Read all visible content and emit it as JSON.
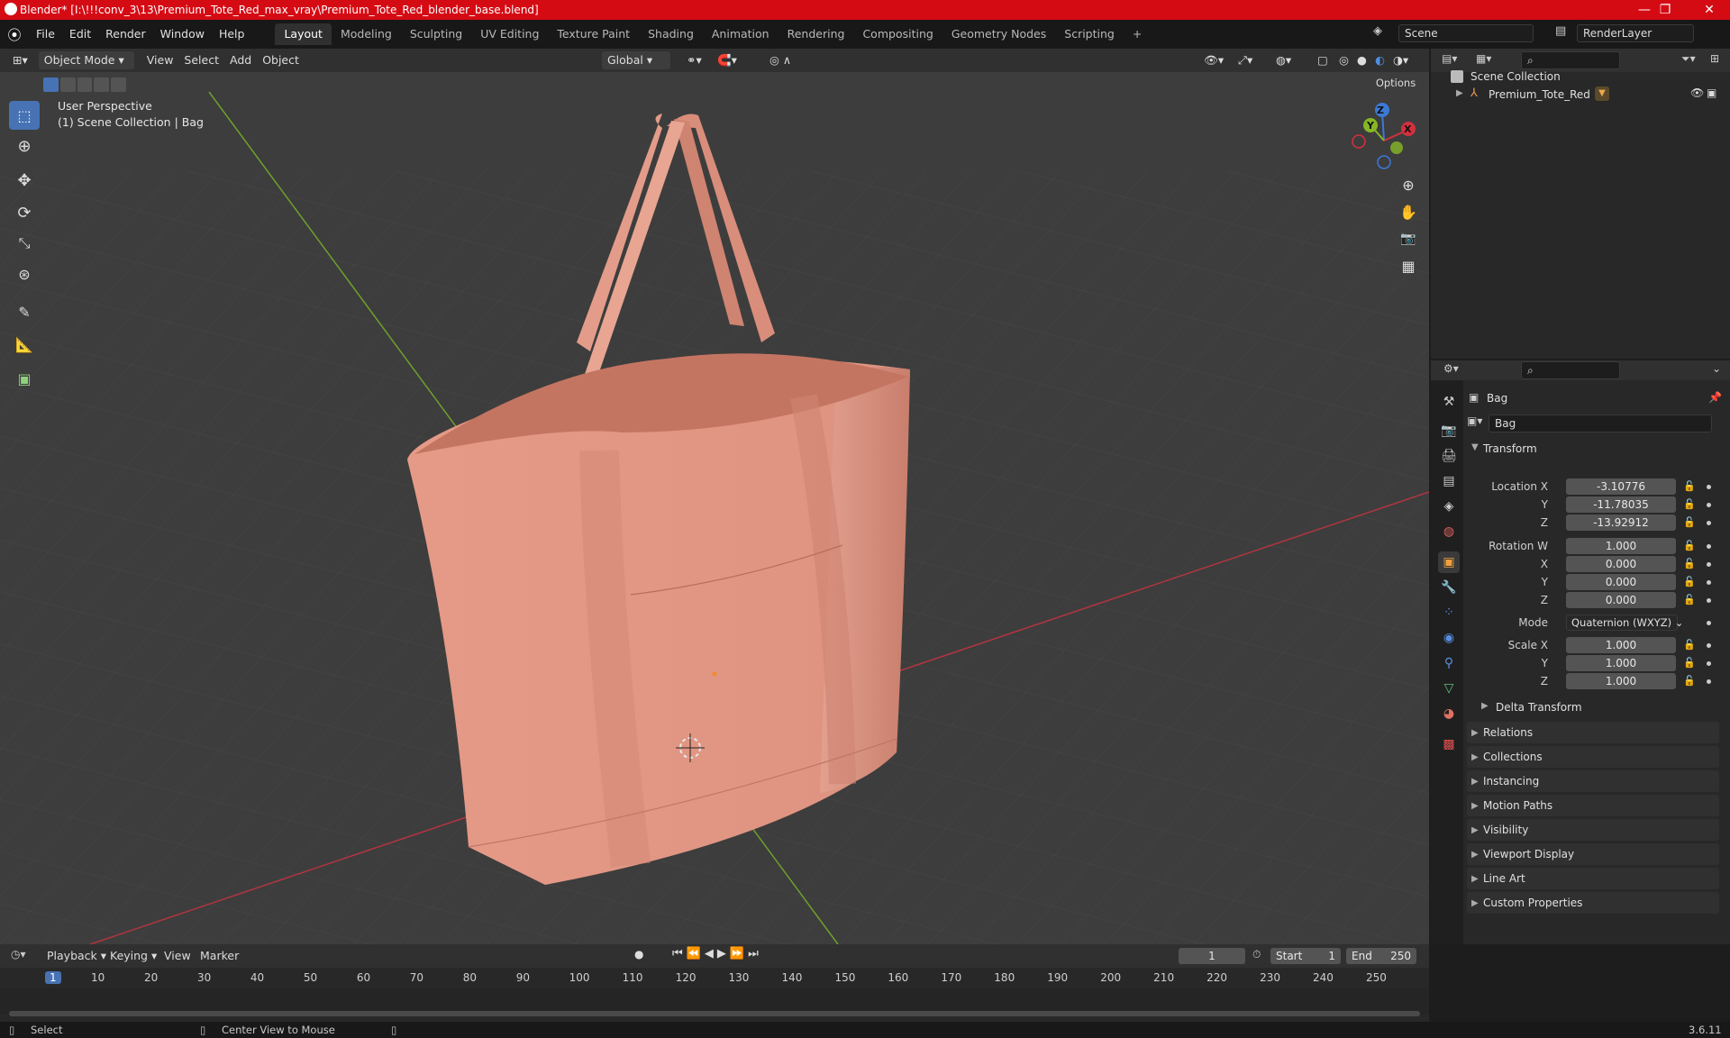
{
  "window": {
    "title": "Blender* [I:\\!!!conv_3\\13\\Premium_Tote_Red_max_vray\\Premium_Tote_Red_blender_base.blend]",
    "minimize": "—",
    "maximize": "❐",
    "close": "✕"
  },
  "menu": {
    "items": [
      "File",
      "Edit",
      "Render",
      "Window",
      "Help"
    ],
    "workspaces": [
      "Layout",
      "Modeling",
      "Sculpting",
      "UV Editing",
      "Texture Paint",
      "Shading",
      "Animation",
      "Rendering",
      "Compositing",
      "Geometry Nodes",
      "Scripting"
    ],
    "add": "+",
    "scene": "Scene",
    "view_layer": "RenderLayer"
  },
  "viewport": {
    "mode": "Object Mode",
    "menus": [
      "View",
      "Select",
      "Add",
      "Object"
    ],
    "orientation": "Global",
    "options": "Options",
    "perspective": "User Perspective",
    "collection_info": "(1) Scene Collection | Bag",
    "gizmo_axes": [
      "Z",
      "Y",
      "X"
    ],
    "colors": {
      "x": "#d3303e",
      "y": "#86b824",
      "z": "#3c79d6",
      "object": "#e29483"
    }
  },
  "outliner": {
    "root": "Scene Collection",
    "items": [
      {
        "name": "Premium_Tote_Red"
      }
    ]
  },
  "properties": {
    "object_name": "Bag",
    "datablock": "Bag",
    "transform_label": "Transform",
    "location": {
      "label": "Location X",
      "x": "-3.10776",
      "y": "-11.78035",
      "z": "-13.92912"
    },
    "rotation": {
      "label": "Rotation W",
      "w": "1.000",
      "x": "0.000",
      "y": "0.000",
      "z": "0.000"
    },
    "mode_label": "Mode",
    "mode_value": "Quaternion (WXYZ)",
    "scale": {
      "label": "Scale X",
      "x": "1.000",
      "y": "1.000",
      "z": "1.000"
    },
    "axis_labels": {
      "y": "Y",
      "z": "Z",
      "x": "X"
    },
    "delta": "Delta Transform",
    "panels": [
      "Relations",
      "Collections",
      "Instancing",
      "Motion Paths",
      "Visibility",
      "Viewport Display",
      "Line Art",
      "Custom Properties"
    ]
  },
  "timeline": {
    "menus": [
      "Playback",
      "Keying",
      "View",
      "Marker"
    ],
    "current_frame": "1",
    "start_label": "Start",
    "start": "1",
    "end_label": "End",
    "end": "250",
    "ticks": [
      "1",
      "10",
      "20",
      "30",
      "40",
      "50",
      "60",
      "70",
      "80",
      "90",
      "100",
      "110",
      "120",
      "130",
      "140",
      "150",
      "160",
      "170",
      "180",
      "190",
      "200",
      "210",
      "220",
      "230",
      "240",
      "250"
    ]
  },
  "status": {
    "select": "Select",
    "center": "Center View to Mouse",
    "version": "3.6.11"
  }
}
